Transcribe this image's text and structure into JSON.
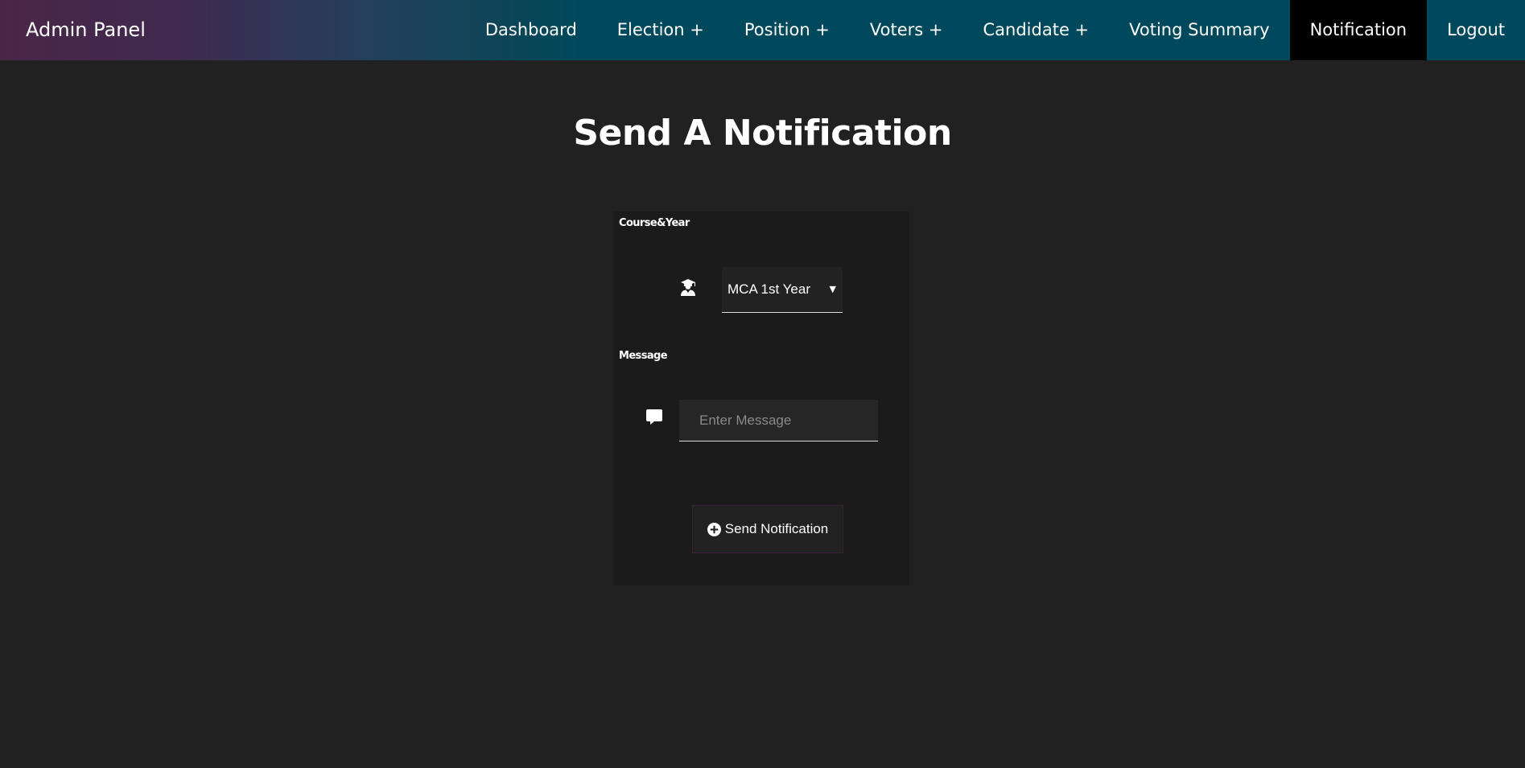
{
  "navbar": {
    "brand": "Admin Panel",
    "links": [
      {
        "label": "Dashboard"
      },
      {
        "label": "Election +"
      },
      {
        "label": "Position +"
      },
      {
        "label": "Voters +"
      },
      {
        "label": "Candidate +"
      },
      {
        "label": "Voting Summary"
      },
      {
        "label": "Notification",
        "active": true
      },
      {
        "label": "Logout"
      }
    ]
  },
  "page": {
    "title": "Send A Notification"
  },
  "form": {
    "course_label": "Course&Year",
    "course_icon": "graduate-icon",
    "course_selected": "MCA 1st Year",
    "message_label": "Message",
    "message_icon": "comment-icon",
    "message_value": "",
    "message_placeholder": "Enter Message",
    "submit_label": "Send Notification",
    "submit_icon": "plus-circle-icon"
  },
  "colors": {
    "page_background": "#212121",
    "card_background": "#1b1b1b",
    "nav_active_background": "#000000",
    "nav_background": "#00495c",
    "nav_gradient_start": "#4a2646"
  }
}
